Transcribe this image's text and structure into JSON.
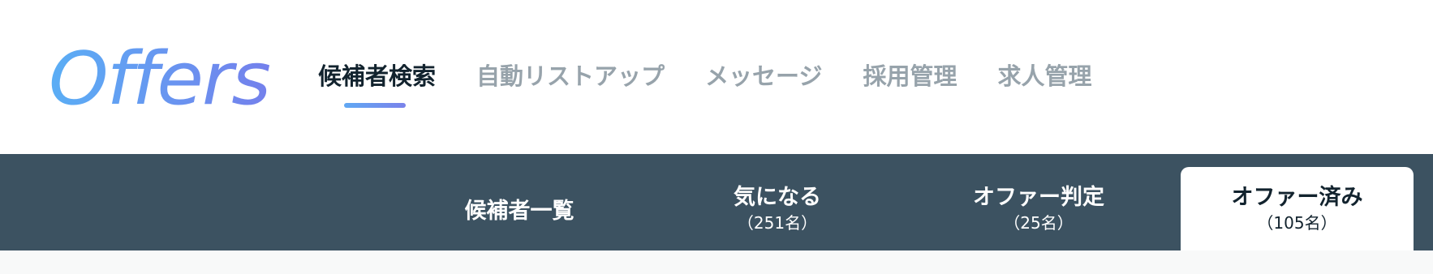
{
  "brand": {
    "logo_text": "Offers",
    "gradient_start": "#5aaef5",
    "gradient_end": "#7480ec"
  },
  "main_nav": {
    "items": [
      {
        "label": "候補者検索",
        "active": true
      },
      {
        "label": "自動リストアップ",
        "active": false
      },
      {
        "label": "メッセージ",
        "active": false
      },
      {
        "label": "採用管理",
        "active": false
      },
      {
        "label": "求人管理",
        "active": false
      }
    ]
  },
  "sub_tabs": {
    "items": [
      {
        "label": "候補者一覧",
        "count": "",
        "active": false
      },
      {
        "label": "気になる",
        "count": "（251名）",
        "active": false
      },
      {
        "label": "オファー判定",
        "count": "（25名）",
        "active": false
      },
      {
        "label": "オファー済み",
        "count": "（105名）",
        "active": true
      }
    ]
  },
  "colors": {
    "subbar_bg": "#3c5261",
    "active_text": "#12232e",
    "inactive_nav_text": "#97a3ab",
    "content_bg": "#f8f9f9"
  }
}
